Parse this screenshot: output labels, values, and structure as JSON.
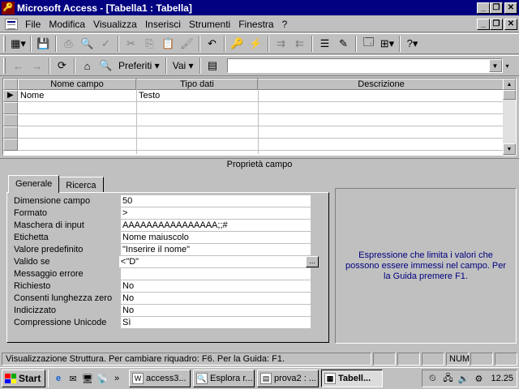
{
  "window": {
    "title": "Microsoft Access - [Tabella1 : Tabella]",
    "app_icon": "access-key-icon"
  },
  "menu": [
    "File",
    "Modifica",
    "Visualizza",
    "Inserisci",
    "Strumenti",
    "Finestra",
    "?"
  ],
  "web_toolbar": {
    "favorites_label": "Preferiti",
    "go_label": "Vai",
    "address_value": ""
  },
  "grid": {
    "headers": [
      "Nome campo",
      "Tipo dati",
      "Descrizione"
    ],
    "rows": [
      {
        "name": "Nome",
        "type": "Testo",
        "description": ""
      }
    ]
  },
  "properties": {
    "section_title": "Proprietà campo",
    "tabs": [
      "Generale",
      "Ricerca"
    ],
    "active_tab": "Generale",
    "rows": [
      {
        "label": "Dimensione campo",
        "value": "50"
      },
      {
        "label": "Formato",
        "value": ">"
      },
      {
        "label": "Maschera di input",
        "value": "AAAAAAAAAAAAAAAA;;#"
      },
      {
        "label": "Etichetta",
        "value": "Nome maiuscolo"
      },
      {
        "label": "Valore predefinito",
        "value": "\"Inserire il nome\""
      },
      {
        "label": "Valido se",
        "value": "<\"D\""
      },
      {
        "label": "Messaggio errore",
        "value": ""
      },
      {
        "label": "Richiesto",
        "value": "No"
      },
      {
        "label": "Consenti lunghezza zero",
        "value": "No"
      },
      {
        "label": "Indicizzato",
        "value": "No"
      },
      {
        "label": "Compressione Unicode",
        "value": "Sì"
      }
    ],
    "builder_label": "..."
  },
  "help_text": "Espressione che limita i valori che possono essere immessi nel campo. Per la Guida premere F1.",
  "statusbar": {
    "message": "Visualizzazione Struttura. Per cambiare riquadro: F6. Per la Guida: F1.",
    "num": "NUM"
  },
  "taskbar": {
    "start_label": "Start",
    "buttons": [
      {
        "label": "access3...",
        "icon": "word-doc-icon"
      },
      {
        "label": "Esplora r...",
        "icon": "explorer-icon"
      },
      {
        "label": "prova2 : ...",
        "icon": "access-db-icon"
      },
      {
        "label": "Tabell...",
        "icon": "table-icon",
        "active": true
      }
    ],
    "clock": "12.25"
  }
}
